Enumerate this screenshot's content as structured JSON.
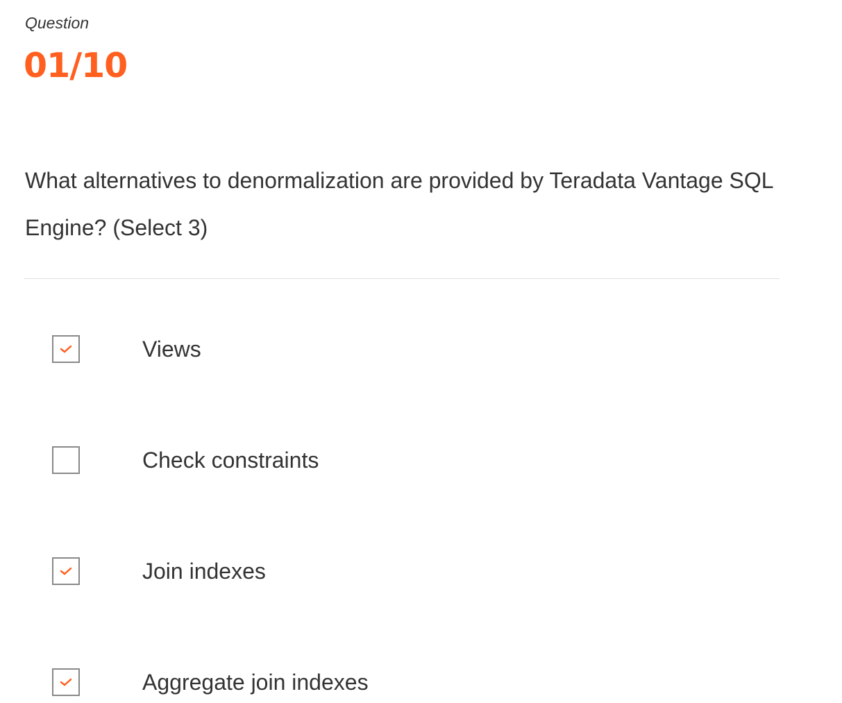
{
  "header": {
    "label": "Question",
    "counter": "01/10"
  },
  "question": {
    "text": "What alternatives to denormalization are provided by Teradata Vantage SQL Engine? (Select 3)"
  },
  "accent_color": "#ff5f1f",
  "options": [
    {
      "label": "Views",
      "checked": true
    },
    {
      "label": "Check constraints",
      "checked": false
    },
    {
      "label": "Join indexes",
      "checked": true
    },
    {
      "label": "Aggregate join indexes",
      "checked": true
    }
  ]
}
